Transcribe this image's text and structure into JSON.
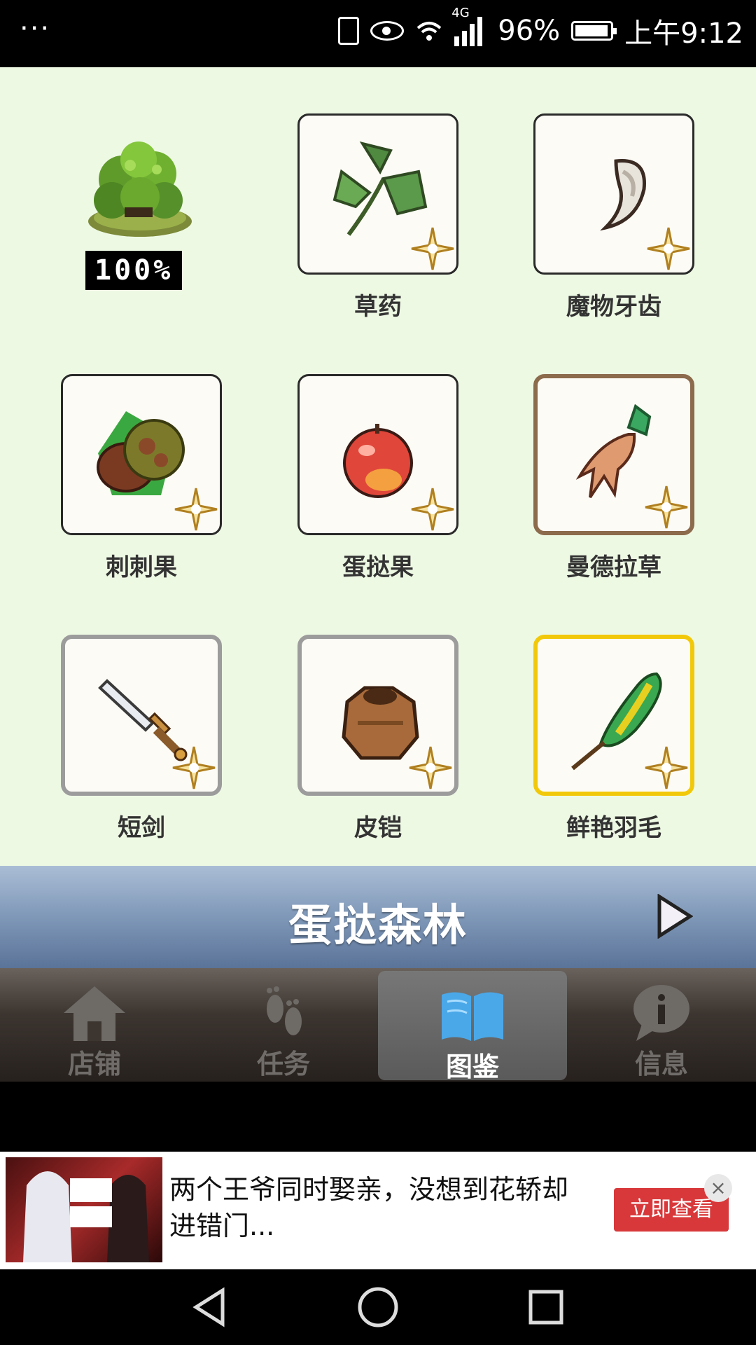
{
  "status_bar": {
    "menu": "···",
    "network": "4G",
    "battery": "96%",
    "time": "上午9:12"
  },
  "collection": {
    "percent": "100%",
    "items": [
      {
        "name": "草药",
        "art": "herb-leaf-icon",
        "rarity": "normal"
      },
      {
        "name": "魔物牙齿",
        "art": "monster-fang-icon",
        "rarity": "normal"
      },
      {
        "name": "刺刺果",
        "art": "spiky-fruit-icon",
        "rarity": "normal"
      },
      {
        "name": "蛋挞果",
        "art": "red-fruit-icon",
        "rarity": "normal"
      },
      {
        "name": "曼德拉草",
        "art": "mandrake-icon",
        "rarity": "bronze"
      },
      {
        "name": "短剑",
        "art": "short-sword-icon",
        "rarity": "silver"
      },
      {
        "name": "皮铠",
        "art": "leather-armor-icon",
        "rarity": "silver"
      },
      {
        "name": "鲜艳羽毛",
        "art": "bright-feather-icon",
        "rarity": "gold"
      }
    ]
  },
  "area": {
    "title": "蛋挞森林"
  },
  "tabs": [
    {
      "label": "店铺",
      "icon": "house-icon",
      "active": false
    },
    {
      "label": "任务",
      "icon": "footprints-icon",
      "active": false
    },
    {
      "label": "图鉴",
      "icon": "open-book-icon",
      "active": true
    },
    {
      "label": "信息",
      "icon": "info-bubble-icon",
      "active": false
    }
  ],
  "ad": {
    "text": "两个王爷同时娶亲，没想到花轿却进错门...",
    "button": "立即查看",
    "close": "×"
  },
  "colors": {
    "background": "#eef9e4",
    "gold_frame": "#f2c90a",
    "silver_frame": "#9c9c9c",
    "bronze_frame": "#8c6a4c",
    "ad_button": "#d8383a"
  }
}
